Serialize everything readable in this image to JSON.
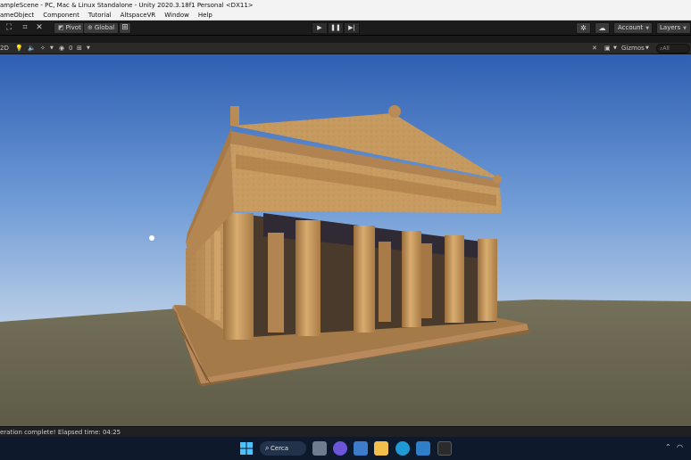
{
  "window": {
    "title": "ampleScene - PC, Mac & Linux Standalone - Unity 2020.3.18f1 Personal <DX11>"
  },
  "menu": [
    "ameObject",
    "Component",
    "Tutorial",
    "AltspaceVR",
    "Window",
    "Help"
  ],
  "toolbar": {
    "pivot_label": "Pivot",
    "global_label": "Global",
    "play_buttons": [
      "▶",
      "❚❚",
      "▶|"
    ],
    "account_label": "Account",
    "layers_label": "Layers"
  },
  "scene_toolbar": {
    "mode_label": "2D",
    "hidden_count": "0",
    "gizmos_label": "Gizmos",
    "search_placeholder": "All"
  },
  "status": {
    "message": "eration complete! Elapsed time: 04:25"
  },
  "taskbar": {
    "search_label": "Cerca"
  },
  "colors": {
    "sky_top": "#3a6cc0",
    "sky_bottom": "#a9c6e8",
    "ground": "#6e6a50",
    "stone": "#c79a5e",
    "editor_dark": "#1b1b1b"
  }
}
